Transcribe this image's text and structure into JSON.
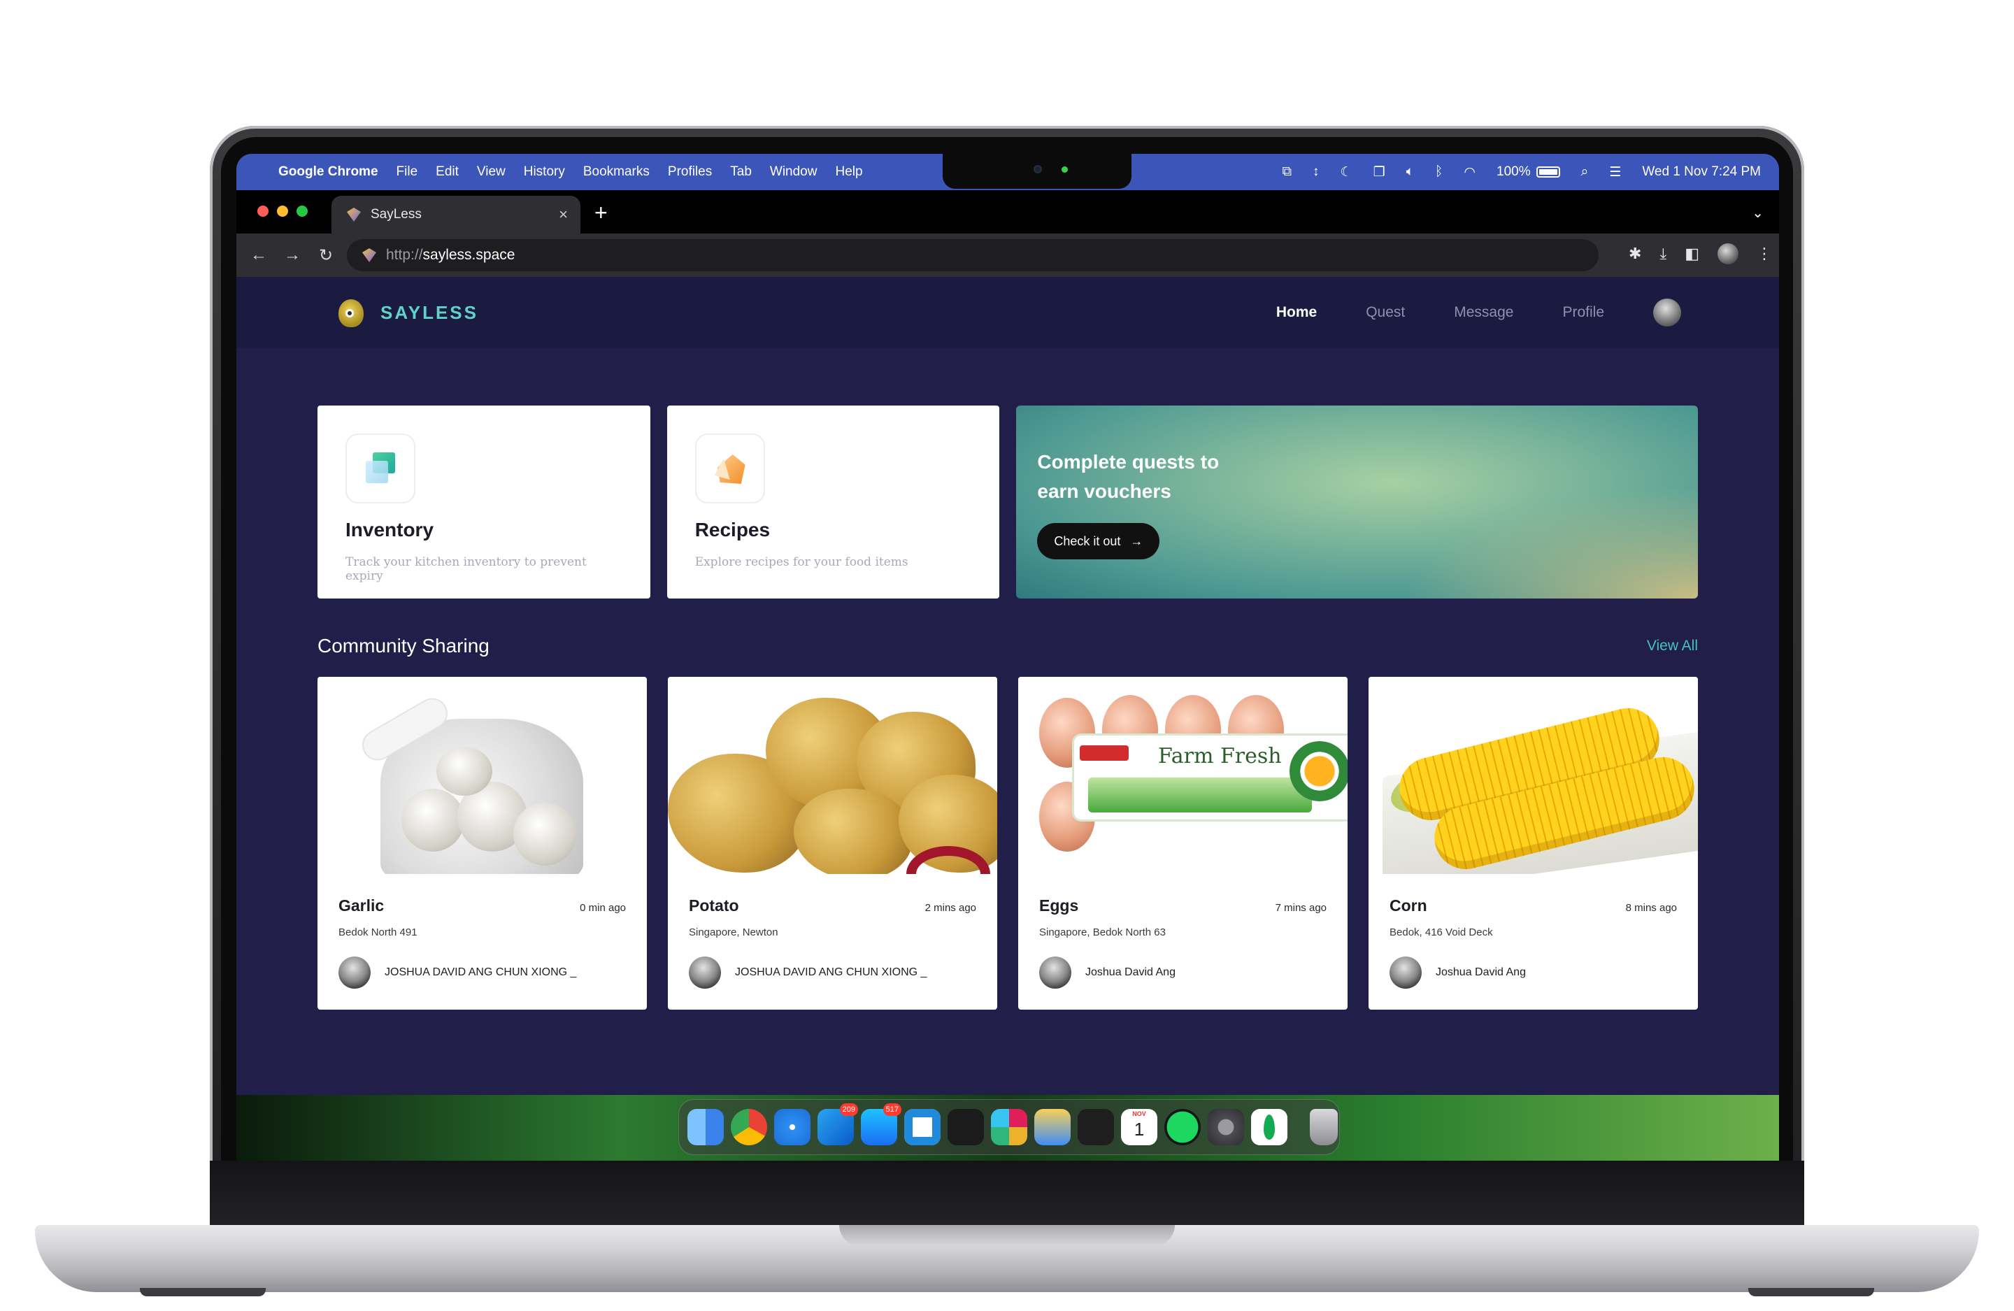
{
  "menubar": {
    "app_name": "Google Chrome",
    "items": [
      "File",
      "Edit",
      "View",
      "History",
      "Bookmarks",
      "Profiles",
      "Tab",
      "Window",
      "Help"
    ],
    "battery": "100%",
    "datetime": "Wed 1 Nov  7:24 PM",
    "status_icons": [
      "layers-icon",
      "arrows-icon",
      "moon-icon",
      "screen-mirror-icon",
      "volume-icon",
      "bluetooth-icon",
      "wifi-icon"
    ]
  },
  "browser": {
    "tab_title": "SayLess",
    "url_scheme": "http://",
    "url_host": "sayless.space"
  },
  "app": {
    "brand": "SAYLESS",
    "nav": [
      "Home",
      "Quest",
      "Message",
      "Profile"
    ],
    "active_nav": "Home",
    "accent_color": "#5fd3c7",
    "background_color": "#211f49"
  },
  "features": [
    {
      "title": "Inventory",
      "subtitle": "Track your kitchen inventory to prevent expiry"
    },
    {
      "title": "Recipes",
      "subtitle": "Explore recipes for your food items"
    }
  ],
  "quest_banner": {
    "title": "Complete quests to earn vouchers",
    "button": "Check it out",
    "button_icon": "→"
  },
  "community": {
    "title": "Community Sharing",
    "view_all": "View All",
    "items": [
      {
        "name": "Garlic",
        "time": "0 min ago",
        "location": "Bedok North 491",
        "user": "JOSHUA DAVID ANG CHUN XIONG _"
      },
      {
        "name": "Potato",
        "time": "2 mins ago",
        "location": "Singapore, Newton",
        "user": "JOSHUA DAVID ANG CHUN XIONG _"
      },
      {
        "name": "Eggs",
        "time": "7 mins ago",
        "location": "Singapore, Bedok North 63",
        "user": "Joshua David Ang",
        "label_text": "Farm Fresh"
      },
      {
        "name": "Corn",
        "time": "8 mins ago",
        "location": "Bedok, 416 Void Deck",
        "user": "Joshua David Ang"
      }
    ]
  },
  "dock": {
    "apps": [
      "finder",
      "chrome",
      "safari",
      "outlook",
      "app-store",
      "vscode",
      "terminal",
      "slack",
      "preview",
      "figma",
      "calendar",
      "spotify",
      "system-settings",
      "mongodb",
      "trash"
    ],
    "badges": {
      "outlook": "209",
      "app-store": "517"
    },
    "calendar": {
      "month": "NOV",
      "day": "1"
    }
  }
}
